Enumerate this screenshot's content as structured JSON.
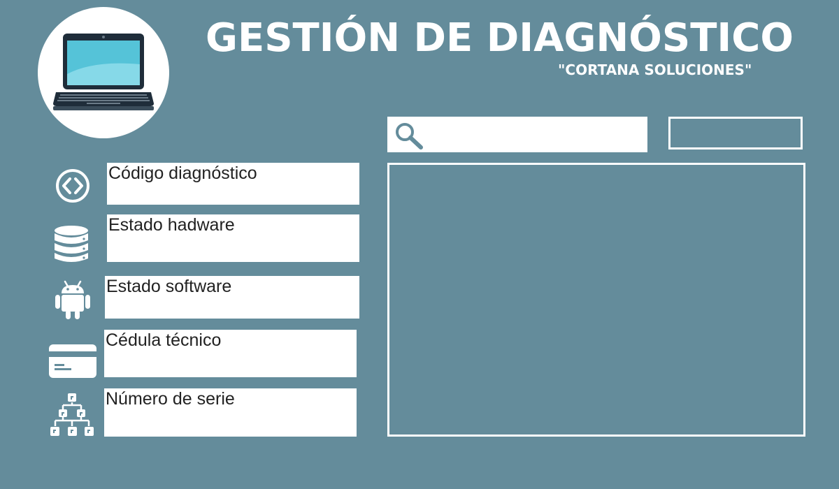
{
  "header": {
    "title": "GESTIÓN DE DIAGNÓSTICO",
    "subtitle": "\"CORTANA SOLUCIONES\"",
    "logo_icon": "laptop-icon"
  },
  "search": {
    "icon": "search-icon",
    "value": "",
    "placeholder": ""
  },
  "action_button": {
    "label": ""
  },
  "form": {
    "fields": [
      {
        "label": "Código diagnóstico",
        "icon": "code-icon",
        "value": ""
      },
      {
        "label": "Estado hadware",
        "icon": "database-icon",
        "value": ""
      },
      {
        "label": "Estado software",
        "icon": "android-icon",
        "value": ""
      },
      {
        "label": "Cédula técnico",
        "icon": "id-card-icon",
        "value": ""
      },
      {
        "label": "Número de serie",
        "icon": "hierarchy-icon",
        "value": ""
      }
    ]
  },
  "results": {
    "content": ""
  },
  "colors": {
    "background": "#648c9b",
    "panel": "#ffffff",
    "accent": "#4aa0b8"
  }
}
